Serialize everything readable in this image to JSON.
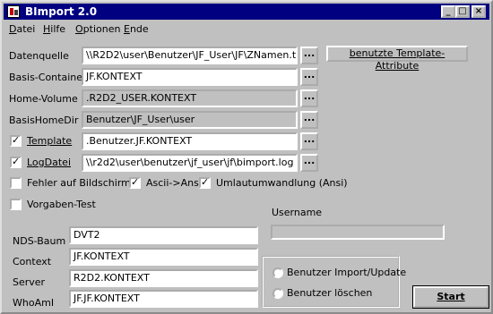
{
  "window": {
    "title": "BImport 2.0",
    "min": "_",
    "max": "□",
    "close": "×"
  },
  "menu": [
    "Datei",
    "Hilfe",
    "Optionen",
    "Ende"
  ],
  "form": {
    "datenquelle": {
      "label": "Datenquelle",
      "value": "\\\\R2D2\\user\\Benutzer\\JF_User\\JF\\ZNamen.txt"
    },
    "basis_container": {
      "label": "Basis-Container",
      "value": "JF.KONTEXT"
    },
    "home_volume": {
      "label": "Home-Volume",
      "value": ".R2D2_USER.KONTEXT"
    },
    "basis_home_dir": {
      "label": "BasisHomeDir",
      "value": "Benutzer\\JF_User\\user"
    },
    "template": {
      "label": "Template",
      "value": ".Benutzer.JF.KONTEXT",
      "checked": true
    },
    "log_datei": {
      "label": "LogDatei",
      "value": "\\\\r2d2\\user\\benutzer\\jf_user\\jf\\bimport.log",
      "checked": true
    },
    "browse_label": "..."
  },
  "template_attr_button": "benutzte Template-Attribute",
  "options": {
    "fehler": {
      "label": "Fehler auf Bildschirm",
      "checked": false
    },
    "ascii": {
      "label": "Ascii->Ansi",
      "checked": true
    },
    "umlaut": {
      "label": "Umlautumwandlung (Ansi)",
      "checked": true
    },
    "vorgaben": {
      "label": "Vorgaben-Test",
      "checked": false
    }
  },
  "username_label": "Username",
  "nds": {
    "baum": {
      "label": "NDS-Baum",
      "value": "DVT2"
    },
    "context": {
      "label": "Context",
      "value": "JF.KONTEXT"
    },
    "server": {
      "label": "Server",
      "value": "R2D2.KONTEXT"
    },
    "whoami": {
      "label": "WhoAmI",
      "value": "JF.JF.KONTEXT"
    }
  },
  "mode": {
    "import_update": "Benutzer Import/Update",
    "loeschen": "Benutzer löschen"
  },
  "start_button": "Start",
  "check_mark": "✓"
}
